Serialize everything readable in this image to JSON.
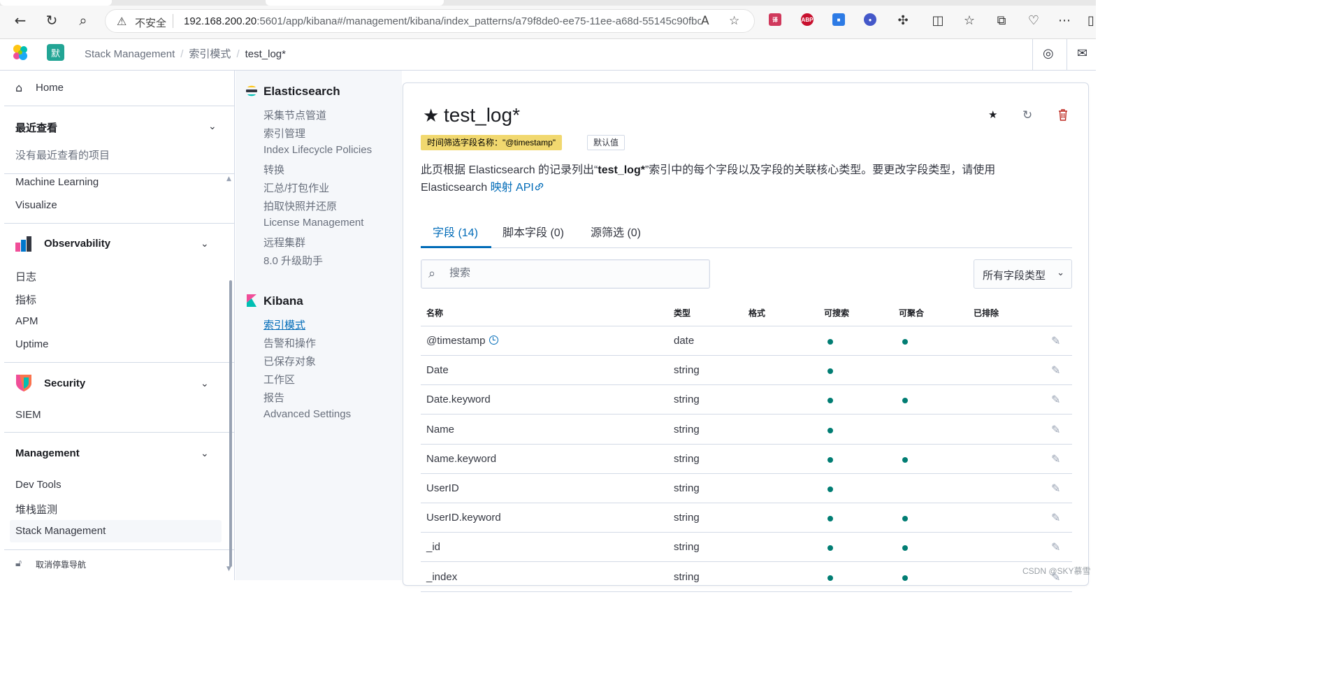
{
  "browser": {
    "security_label": "不安全",
    "url_host": "192.168.200.20",
    "url_rest": ":5601/app/kibana#/management/kibana/index_patterns/a79f8de0-ee75-11ee-a68d-55145c90fbc..."
  },
  "header": {
    "space_initial": "默",
    "breadcrumbs": [
      "Stack Management",
      "索引模式",
      "test_log*"
    ]
  },
  "leftnav": {
    "home": "Home",
    "recent_title": "最近查看",
    "recent_empty": "没有最近查看的项目",
    "analytics_items": [
      "Machine Learning",
      "Visualize"
    ],
    "observability_title": "Observability",
    "observability_items": [
      "日志",
      "指标",
      "APM",
      "Uptime"
    ],
    "security_title": "Security",
    "security_items": [
      "SIEM"
    ],
    "management_title": "Management",
    "management_items": [
      "Dev Tools",
      "堆栈监测",
      "Stack Management"
    ],
    "undock": "取消停靠导航"
  },
  "midnav": {
    "elasticsearch_title": "Elasticsearch",
    "elasticsearch_items": [
      "采集节点管道",
      "索引管理",
      "Index Lifecycle Policies",
      "转换",
      "汇总/打包作业",
      "拍取快照并还原",
      "License Management",
      "远程集群",
      "8.0 升级助手"
    ],
    "kibana_title": "Kibana",
    "kibana_items": [
      "索引模式",
      "告警和操作",
      "已保存对象",
      "工作区",
      "报告",
      "Advanced Settings"
    ]
  },
  "main": {
    "title": "test_log*",
    "time_badge": "时间筛选字段名称：\"@timestamp\"",
    "default_badge": "默认值",
    "desc_prefix": "此页根据 Elasticsearch 的记录列出“",
    "desc_bold": "test_log*",
    "desc_suffix": "”索引中的每个字段以及字段的关联核心类型。要更改字段类型，请使用 Elasticsearch ",
    "desc_link": "映射 API",
    "tabs": [
      "字段 (14)",
      "脚本字段 (0)",
      "源筛选 (0)"
    ],
    "search_placeholder": "搜索",
    "type_filter": "所有字段类型",
    "columns": [
      "名称",
      "类型",
      "格式",
      "可搜索",
      "可聚合",
      "已排除"
    ],
    "rows": [
      {
        "name": "@timestamp",
        "type": "date",
        "searchable": true,
        "aggregatable": true
      },
      {
        "name": "Date",
        "type": "string",
        "searchable": true,
        "aggregatable": false
      },
      {
        "name": "Date.keyword",
        "type": "string",
        "searchable": true,
        "aggregatable": true
      },
      {
        "name": "Name",
        "type": "string",
        "searchable": true,
        "aggregatable": false
      },
      {
        "name": "Name.keyword",
        "type": "string",
        "searchable": true,
        "aggregatable": true
      },
      {
        "name": "UserID",
        "type": "string",
        "searchable": true,
        "aggregatable": false
      },
      {
        "name": "UserID.keyword",
        "type": "string",
        "searchable": true,
        "aggregatable": true
      },
      {
        "name": "_id",
        "type": "string",
        "searchable": true,
        "aggregatable": true
      },
      {
        "name": "_index",
        "type": "string",
        "searchable": true,
        "aggregatable": true
      }
    ]
  },
  "watermark": "CSDN @SKY慕雪",
  "colors": {
    "accent": "#006bb8",
    "dot": "#017d73",
    "time_badge": "#f1d86f",
    "space_badge": "#22a595",
    "delete": "#bd271e"
  }
}
